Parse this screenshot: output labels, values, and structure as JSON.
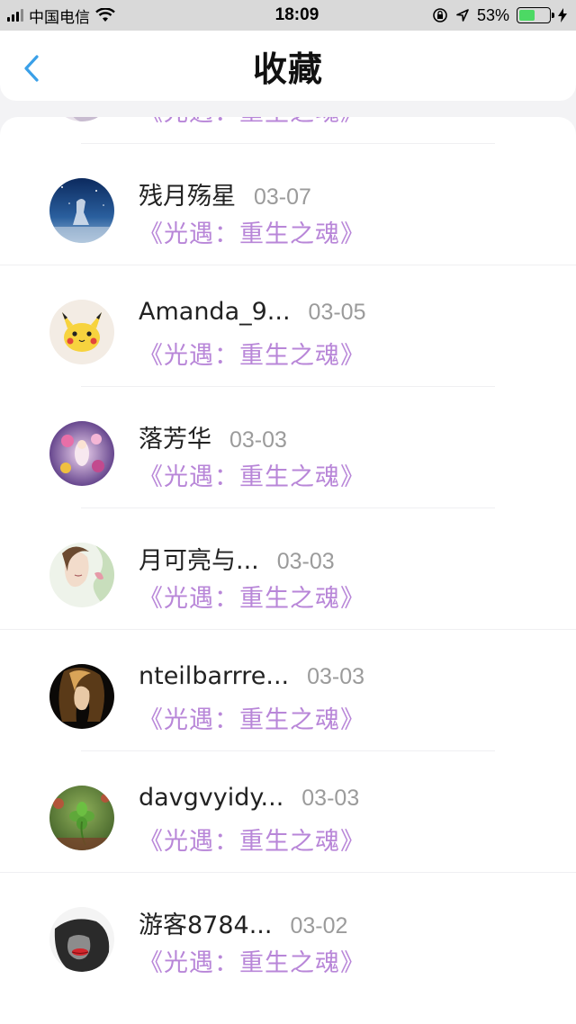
{
  "status_bar": {
    "carrier": "中国电信",
    "time": "18:09",
    "battery_percent": "53%",
    "battery_level": 0.53,
    "icons": [
      "signal-icon",
      "wifi-icon",
      "orientation-lock-icon",
      "location-icon",
      "battery-icon",
      "charging-icon"
    ]
  },
  "nav": {
    "title": "收藏",
    "back_icon": "chevron-left-icon"
  },
  "colors": {
    "accent": "#3aa0e8",
    "game_title": "#b886d8",
    "date": "#9b9b9b",
    "battery": "#4cd964"
  },
  "favorites": [
    {
      "name": "",
      "date": "",
      "game": "《光遇：重生之魂》"
    },
    {
      "name": "残月殇星",
      "date": "03-07",
      "game": "《光遇：重生之魂》"
    },
    {
      "name": "Amanda_9...",
      "date": "03-05",
      "game": "《光遇：重生之魂》"
    },
    {
      "name": "落芳华",
      "date": "03-03",
      "game": "《光遇：重生之魂》"
    },
    {
      "name": "月可亮与...",
      "date": "03-03",
      "game": "《光遇：重生之魂》"
    },
    {
      "name": "nteilbarrre...",
      "date": "03-03",
      "game": "《光遇：重生之魂》"
    },
    {
      "name": "davgvyidy...",
      "date": "03-03",
      "game": "《光遇：重生之魂》"
    },
    {
      "name": "游客8784...",
      "date": "03-02",
      "game": "《光遇：重生之魂》"
    }
  ]
}
